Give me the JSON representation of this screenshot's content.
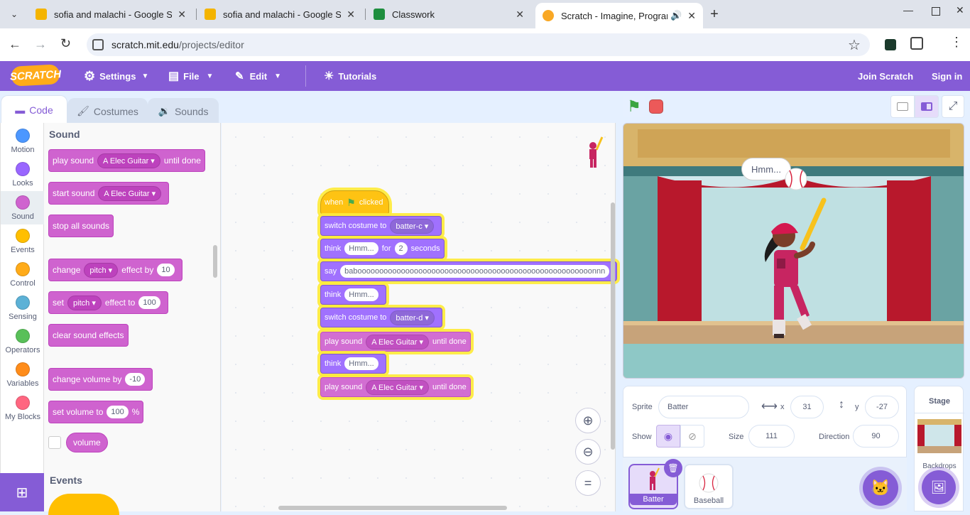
{
  "browser": {
    "tabs": [
      {
        "title": "sofia and malachi - Google Slid",
        "favicon_color": "#f4b400"
      },
      {
        "title": "sofia and malachi - Google Slid",
        "favicon_color": "#f4b400"
      },
      {
        "title": "Classwork",
        "favicon_color": "#1e8e3e"
      },
      {
        "title": "Scratch - Imagine, Program",
        "favicon_color": "#f9a825"
      }
    ],
    "url_host": "scratch.mit.edu",
    "url_path": "/projects/editor"
  },
  "menubar": {
    "logo": "SCRATCH",
    "settings": "Settings",
    "file": "File",
    "edit": "Edit",
    "tutorials": "Tutorials",
    "join": "Join Scratch",
    "signin": "Sign in"
  },
  "editor_tabs": {
    "code": "Code",
    "costumes": "Costumes",
    "sounds": "Sounds"
  },
  "categories": [
    {
      "label": "Motion",
      "color": "#4c97ff"
    },
    {
      "label": "Looks",
      "color": "#9966ff"
    },
    {
      "label": "Sound",
      "color": "#cf63cf"
    },
    {
      "label": "Events",
      "color": "#ffbf00"
    },
    {
      "label": "Control",
      "color": "#ffab19"
    },
    {
      "label": "Sensing",
      "color": "#5cb1d6"
    },
    {
      "label": "Operators",
      "color": "#59c059"
    },
    {
      "label": "Variables",
      "color": "#ff8c1a"
    },
    {
      "label": "My Blocks",
      "color": "#ff6680"
    }
  ],
  "palette": {
    "section": "Sound",
    "section2": "Events",
    "play_sound": {
      "pre": "play sound",
      "sound": "A Elec Guitar",
      "post": "until done"
    },
    "start_sound": {
      "pre": "start sound",
      "sound": "A Elec Guitar"
    },
    "stop_all": "stop all sounds",
    "change_effect": {
      "pre": "change",
      "effect": "pitch",
      "mid": "effect by",
      "value": "10"
    },
    "set_effect": {
      "pre": "set",
      "effect": "pitch",
      "mid": "effect to",
      "value": "100"
    },
    "clear_effects": "clear sound effects",
    "change_volume": {
      "pre": "change volume by",
      "value": "-10"
    },
    "set_volume": {
      "pre": "set volume to",
      "value": "100",
      "post": "%"
    },
    "volume": "volume"
  },
  "script": {
    "hat": {
      "pre": "when",
      "post": "clicked"
    },
    "b1": {
      "pre": "switch costume to",
      "costume": "batter-c"
    },
    "b2": {
      "pre": "think",
      "text": "Hmm...",
      "mid": "for",
      "secs": "2",
      "post": "seconds"
    },
    "b3": {
      "pre": "say",
      "text": "baboooooooooooooooooooooooooooooooooooooooooooooooooooooonnn"
    },
    "b4": {
      "pre": "think",
      "text": "Hmm..."
    },
    "b5": {
      "pre": "switch costume to",
      "costume": "batter-d"
    },
    "b6": {
      "pre": "play sound",
      "sound": "A Elec Guitar",
      "post": "until done"
    },
    "b7": {
      "pre": "think",
      "text": "Hmm..."
    },
    "b8": {
      "pre": "play sound",
      "sound": "A Elec Guitar",
      "post": "until done"
    }
  },
  "stage": {
    "thought": "Hmm..."
  },
  "sprite_info": {
    "sprite_label": "Sprite",
    "sprite_name": "Batter",
    "x_label": "x",
    "x": "31",
    "y_label": "y",
    "y": "-27",
    "show_label": "Show",
    "size_label": "Size",
    "size": "111",
    "direction_label": "Direction",
    "direction": "90"
  },
  "sprites": [
    {
      "name": "Batter"
    },
    {
      "name": "Baseball"
    }
  ],
  "stage_pane": {
    "title": "Stage",
    "backdrops": "Backdrops"
  }
}
